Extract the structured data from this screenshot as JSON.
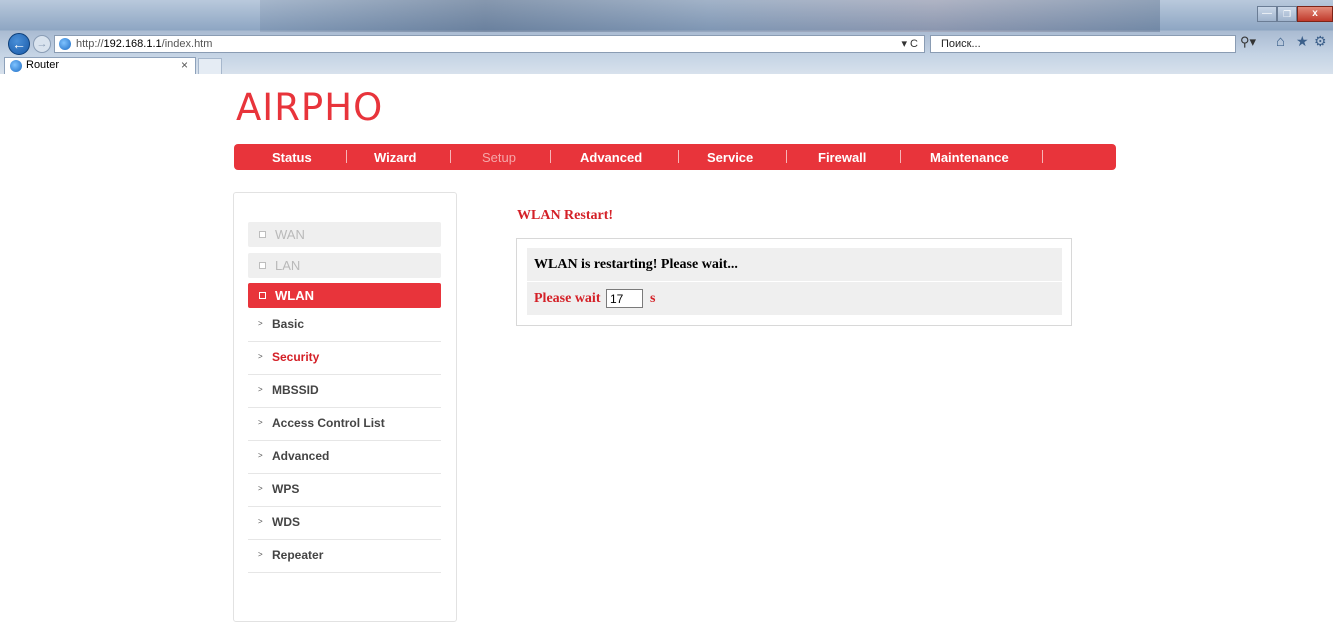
{
  "browser": {
    "url_prefix": "http://",
    "url_host": "192.168.1.1",
    "url_path": "/index.htm",
    "url_controls": "▾ C",
    "search_placeholder": "Поиск...",
    "tab_title": "Router",
    "tab_close": "×",
    "back_glyph": "←",
    "forward_glyph": "→",
    "search_glyph": "⚲▾",
    "home_glyph": "⌂",
    "star_glyph": "★",
    "gear_glyph": "⚙",
    "min_glyph": "—",
    "max_glyph": "❐",
    "close_glyph": "x"
  },
  "logo": "AIRPHO",
  "nav": {
    "items": [
      {
        "label": "Status"
      },
      {
        "label": "Wizard"
      },
      {
        "label": "Setup"
      },
      {
        "label": "Advanced"
      },
      {
        "label": "Service"
      },
      {
        "label": "Firewall"
      },
      {
        "label": "Maintenance"
      }
    ],
    "active": "Setup"
  },
  "sidebar": {
    "main": [
      {
        "label": "WAN"
      },
      {
        "label": "LAN"
      },
      {
        "label": "WLAN"
      }
    ],
    "sub": [
      {
        "label": "Basic"
      },
      {
        "label": "Security"
      },
      {
        "label": "MBSSID"
      },
      {
        "label": "Access Control List"
      },
      {
        "label": "Advanced"
      },
      {
        "label": "WPS"
      },
      {
        "label": "WDS"
      },
      {
        "label": "Repeater"
      }
    ],
    "active_main": "WLAN",
    "active_sub": "Security"
  },
  "content": {
    "title": "WLAN Restart!",
    "message": "WLAN is restarting! Please wait...",
    "wait_label": "Please wait",
    "wait_value": "17",
    "wait_unit": "s"
  },
  "colors": {
    "accent": "#e8343b",
    "accent_text": "#d42027"
  }
}
